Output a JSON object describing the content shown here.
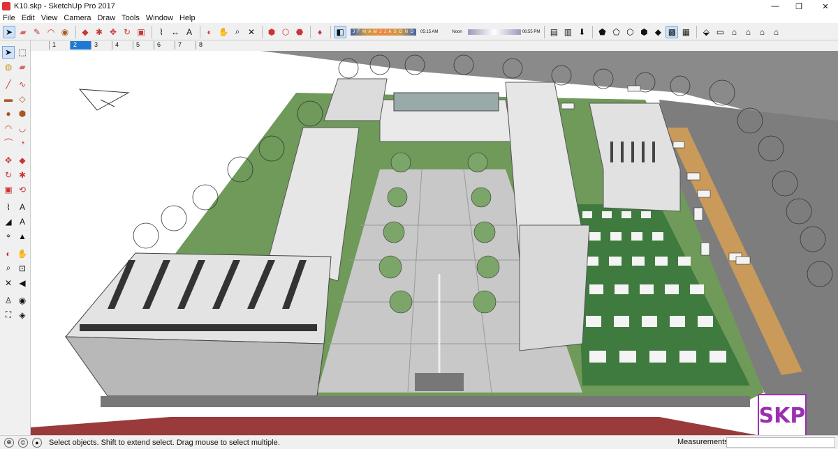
{
  "window": {
    "title": "K10.skp - SketchUp Pro 2017",
    "minimize": "—",
    "maximize": "❐",
    "close": "✕"
  },
  "menu": [
    "File",
    "Edit",
    "View",
    "Camera",
    "Draw",
    "Tools",
    "Window",
    "Help"
  ],
  "shadow_settings": {
    "months": "J F M A M J J A S O N D",
    "time_start": "05:15 AM",
    "time_noon": "Noon",
    "time_end": "06:55 PM"
  },
  "scene_tabs": [
    "1",
    "2",
    "3",
    "4",
    "5",
    "6",
    "7",
    "8"
  ],
  "active_scene_tab": "2",
  "status": {
    "hint": "Select objects. Shift to extend select. Drag mouse to select multiple.",
    "measurements_label": "Measurements",
    "measurements_value": ""
  },
  "watermark": "SKP",
  "colors": {
    "accent": "#1c7ad4",
    "grass": "#6f9a5a",
    "road": "#888888",
    "watermark": "#9b2fb0"
  }
}
